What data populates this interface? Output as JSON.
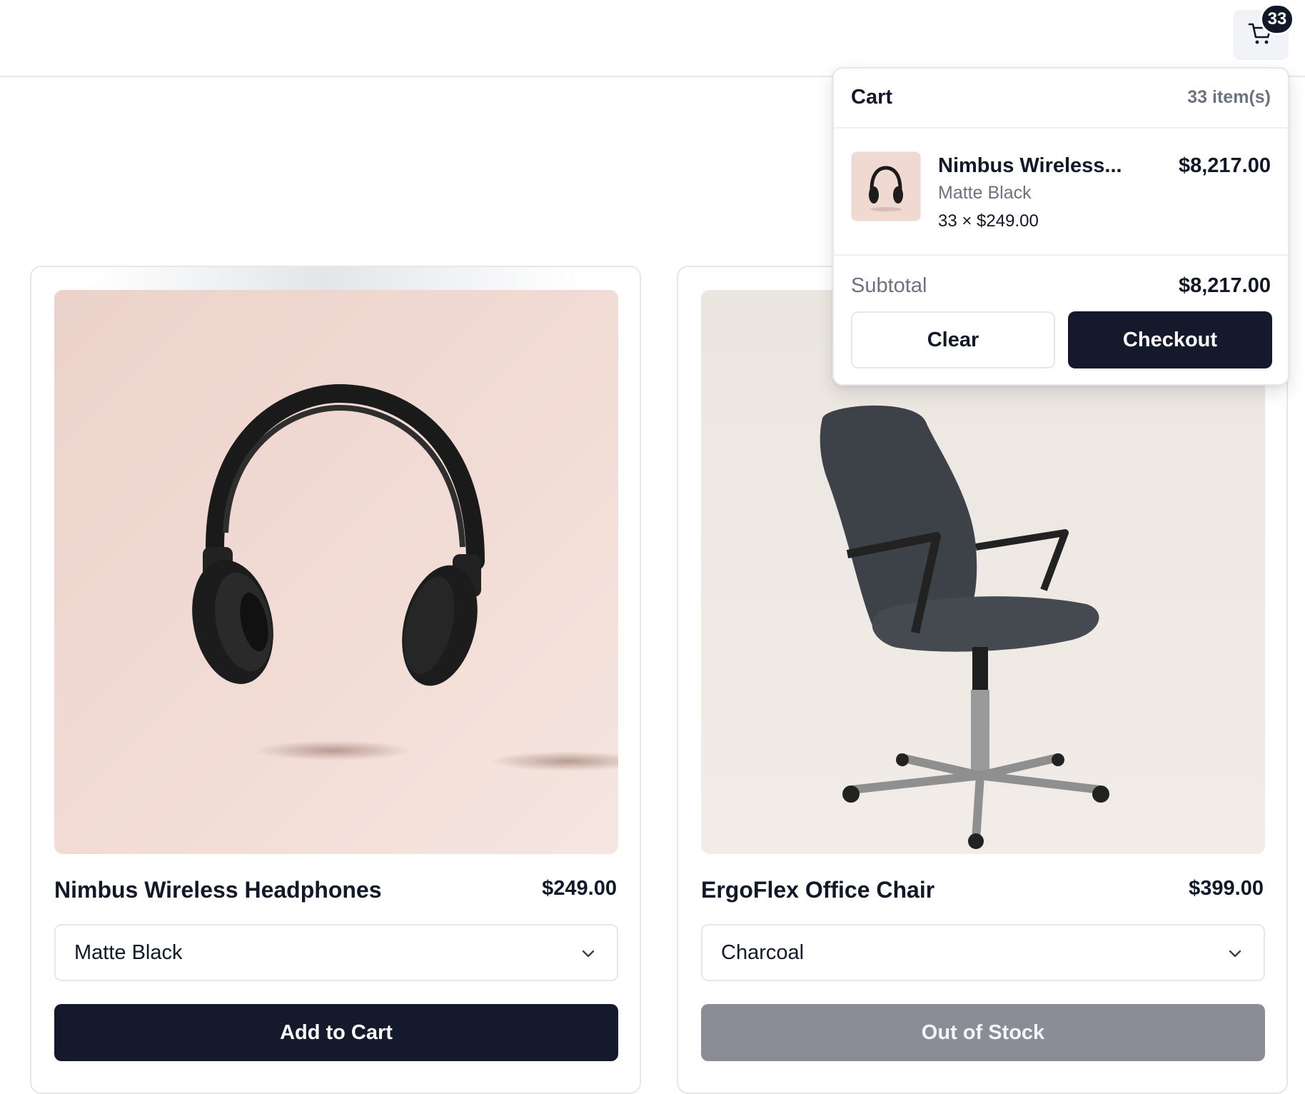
{
  "header": {
    "cart_button_icon": "shopping-cart-icon",
    "cart_badge_count": "33"
  },
  "products": [
    {
      "title": "Nimbus Wireless Headphones",
      "price": "$249.00",
      "image_icon": "headphones-image",
      "selected_variant": "Matte Black",
      "action_label": "Add to Cart",
      "in_stock": true
    },
    {
      "title": "ErgoFlex Office Chair",
      "price": "$399.00",
      "image_icon": "office-chair-image",
      "selected_variant": "Charcoal",
      "action_label": "Out of Stock",
      "in_stock": false
    }
  ],
  "cart": {
    "title": "Cart",
    "count_label": "33 item(s)",
    "items": [
      {
        "name": "Nimbus Wireless...",
        "variant": "Matte Black",
        "qty_price": "33 × $249.00",
        "line_total": "$8,217.00"
      }
    ],
    "subtotal_label": "Subtotal",
    "subtotal_value": "$8,217.00",
    "clear_label": "Clear",
    "checkout_label": "Checkout"
  },
  "colors": {
    "primary": "#141a2c",
    "disabled": "#8a8d96",
    "muted_text": "#6b7280",
    "border": "#e5e7eb"
  }
}
